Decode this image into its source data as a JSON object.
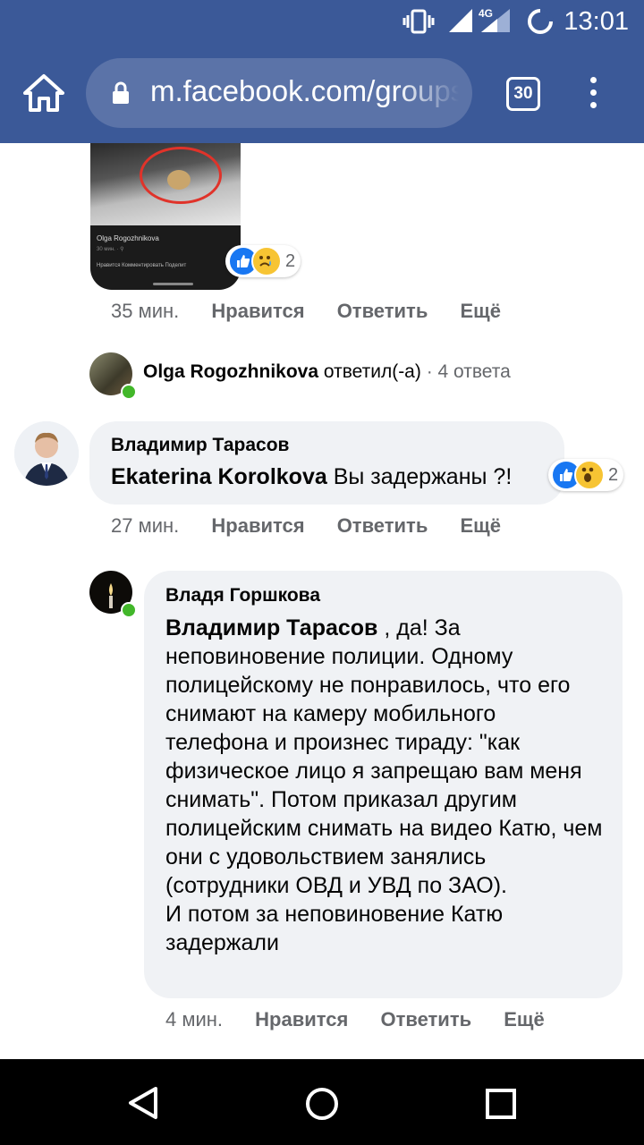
{
  "status_bar": {
    "time": "13:01",
    "network": "4G",
    "icons": [
      "vibrate-icon",
      "signal-icon",
      "data-saver-icon"
    ]
  },
  "browser": {
    "url": "m.facebook.com/groups",
    "tab_count": "30",
    "icons": [
      "home-icon",
      "lock-icon",
      "overflow-menu-icon"
    ]
  },
  "shared_image": {
    "caption_name": "Olga Rogozhnikova",
    "caption_time": "30 мин. · ⚲",
    "caption_actions": "Нравится   Комментировать   Поделит"
  },
  "first_comment": {
    "reaction_count": "2",
    "time": "35 мин.",
    "like": "Нравится",
    "reply": "Ответить",
    "more": "Ещё"
  },
  "reply_summary": {
    "name": "Olga Rogozhnikova",
    "action": "ответил(-а)",
    "count": "· 4 ответа"
  },
  "comment2": {
    "author": "Владимир Тарасов",
    "mention": "Ekaterina Korolkova",
    "text": "Вы задержаны ?!",
    "reaction_count": "2",
    "time": "27 мин.",
    "like": "Нравится",
    "reply": "Ответить",
    "more": "Ещё"
  },
  "comment3": {
    "author": "Владя Горшкова",
    "mention": "Владимир Тарасов",
    "text": " , да! За неповиновение полиции. Одному полицейскому не понравилось, что его снимают на камеру мобильного телефона и произнес тираду: \"как физическое лицо я запрещаю вам меня снимать\". Потом приказал другим полицейским снимать на видео Катю, чем они с удовольствием занялись (сотрудники ОВД и УВД по ЗАО).",
    "text2": "И потом за неповиновение Катю задержали",
    "time": "4 мин.",
    "like": "Нравится",
    "reply": "Ответить",
    "more": "Ещё"
  },
  "colors": {
    "facebook_blue": "#3b5998",
    "like_blue": "#1877f2",
    "bubble_gray": "#f0f2f5",
    "online_green": "#42b72a"
  }
}
